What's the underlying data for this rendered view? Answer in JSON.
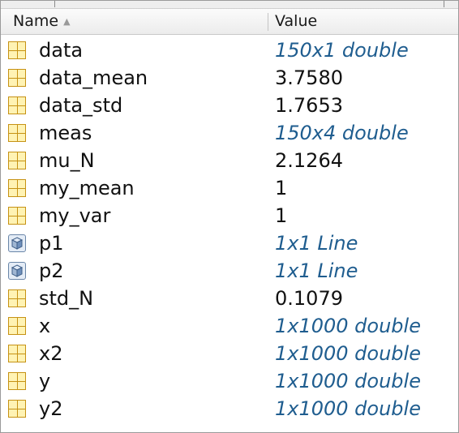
{
  "header": {
    "name_label": "Name",
    "value_label": "Value",
    "sort_icon": "sort-ascending-icon",
    "sort_glyph": "▲"
  },
  "colors": {
    "numeric_value": "#111111",
    "summary_value": "#1f5d8f",
    "array_icon_fill": "#fff3b4",
    "array_icon_border": "#c69214"
  },
  "variables": [
    {
      "name": "data",
      "value": "150x1 double",
      "icon": "array-icon",
      "italic": true
    },
    {
      "name": "data_mean",
      "value": "3.7580",
      "icon": "array-icon",
      "italic": false
    },
    {
      "name": "data_std",
      "value": "1.7653",
      "icon": "array-icon",
      "italic": false
    },
    {
      "name": "meas",
      "value": "150x4 double",
      "icon": "array-icon",
      "italic": true
    },
    {
      "name": "mu_N",
      "value": "2.1264",
      "icon": "array-icon",
      "italic": false
    },
    {
      "name": "my_mean",
      "value": "1",
      "icon": "array-icon",
      "italic": false
    },
    {
      "name": "my_var",
      "value": "1",
      "icon": "array-icon",
      "italic": false
    },
    {
      "name": "p1",
      "value": "1x1 Line",
      "icon": "object-icon",
      "italic": true
    },
    {
      "name": "p2",
      "value": "1x1 Line",
      "icon": "object-icon",
      "italic": true
    },
    {
      "name": "std_N",
      "value": "0.1079",
      "icon": "array-icon",
      "italic": false
    },
    {
      "name": "x",
      "value": "1x1000 double",
      "icon": "array-icon",
      "italic": true
    },
    {
      "name": "x2",
      "value": "1x1000 double",
      "icon": "array-icon",
      "italic": true
    },
    {
      "name": "y",
      "value": "1x1000 double",
      "icon": "array-icon",
      "italic": true
    },
    {
      "name": "y2",
      "value": "1x1000 double",
      "icon": "array-icon",
      "italic": true
    }
  ]
}
